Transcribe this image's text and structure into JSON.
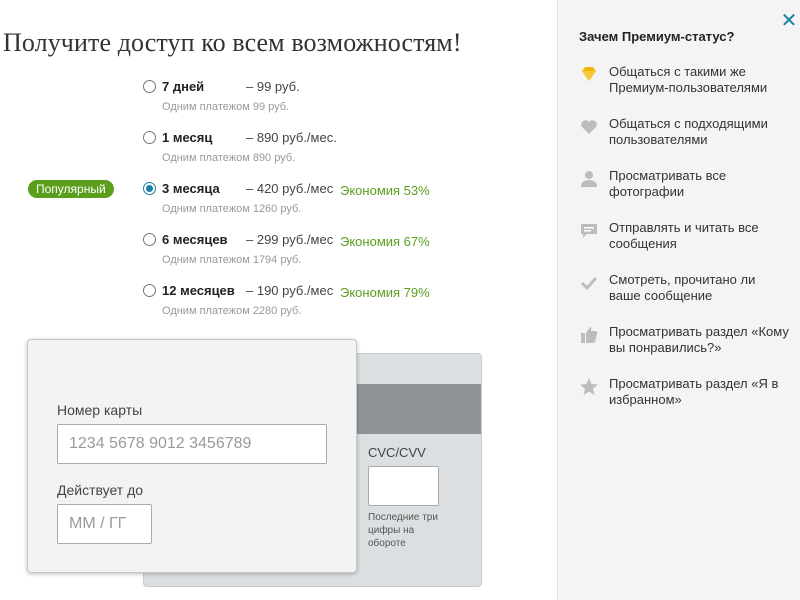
{
  "page": {
    "title": "Получите доступ ко всем возможностям!"
  },
  "plans": [
    {
      "duration": "7 дней",
      "price": "– 99 руб.",
      "note": "Одним платежом 99 руб.",
      "savings": "",
      "selected": false,
      "badge": ""
    },
    {
      "duration": "1 месяц",
      "price": "– 890 руб./мес.",
      "note": "Одним платежом 890 руб.",
      "savings": "",
      "selected": false,
      "badge": ""
    },
    {
      "duration": "3 месяца",
      "price": "– 420 руб./мес",
      "note": "Одним платежом 1260 руб.",
      "savings": "Экономия 53%",
      "selected": true,
      "badge": "Популярный"
    },
    {
      "duration": "6 месяцев",
      "price": "– 299 руб./мес",
      "note": "Одним платежом 1794 руб.",
      "savings": "Экономия 67%",
      "selected": false,
      "badge": ""
    },
    {
      "duration": "12 месяцев",
      "price": "– 190 руб./мес",
      "note": "Одним платежом 2280 руб.",
      "savings": "Экономия 79%",
      "selected": false,
      "badge": ""
    }
  ],
  "card_form": {
    "number_label": "Номер карты",
    "number_placeholder": "1234 5678 9012 3456789",
    "expiry_label": "Действует до",
    "expiry_placeholder": "ММ / ГГ",
    "cvc_label": "CVC/CVV",
    "cvc_hint": "Последние три цифры на обороте"
  },
  "sidebar": {
    "title": "Зачем Премиум-статус?",
    "close_icon": "close-icon",
    "benefits": [
      {
        "icon": "diamond-icon",
        "text": "Общаться с такими же Премиум-пользователями"
      },
      {
        "icon": "heart-icon",
        "text": "Общаться с подходящими пользователями"
      },
      {
        "icon": "person-icon",
        "text": "Просматривать все фотографии"
      },
      {
        "icon": "chat-icon",
        "text": "Отправлять и читать все сообщения"
      },
      {
        "icon": "checkmark-icon",
        "text": "Смотреть, прочитано ли ваше сообщение"
      },
      {
        "icon": "thumbs-up-icon",
        "text": "Просматривать раздел «Кому вы понравились?»"
      },
      {
        "icon": "star-icon",
        "text": "Просматривать раздел «Я в избранном»"
      }
    ]
  },
  "colors": {
    "accent_blue": "#1a7fa8",
    "savings_green": "#5a9e1c",
    "icon_grey": "#bdbdbd",
    "diamond_gold": "#f2b705"
  }
}
